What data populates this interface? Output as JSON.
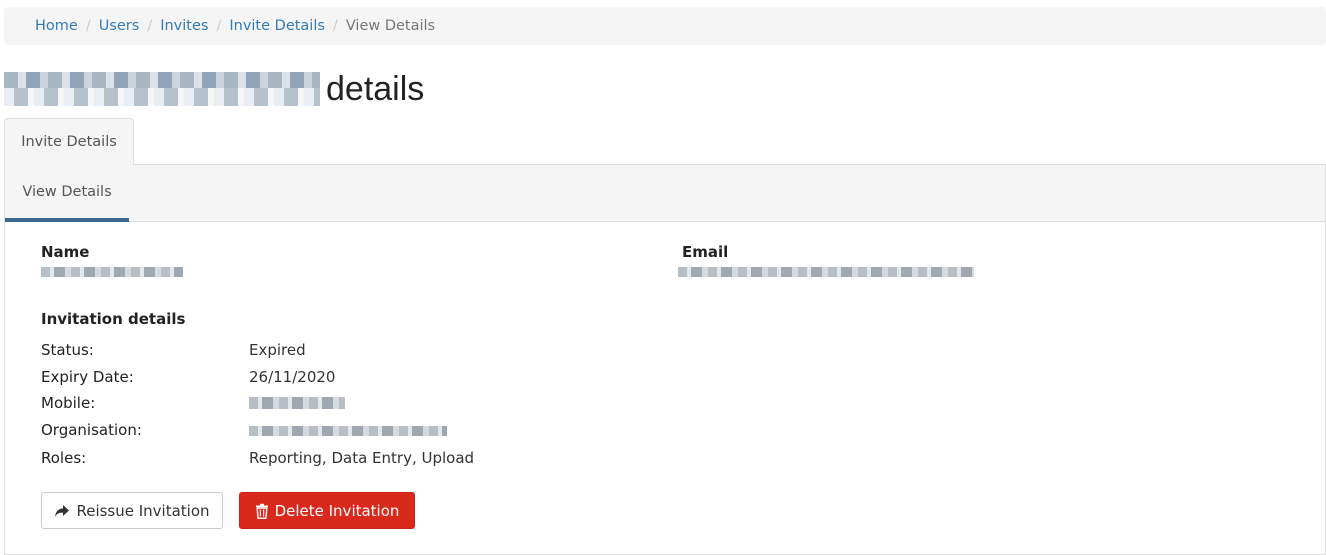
{
  "breadcrumb": {
    "items": [
      "Home",
      "Users",
      "Invites",
      "Invite Details",
      "View Details"
    ],
    "separator": "/"
  },
  "page": {
    "title_suffix": "details"
  },
  "tabs": {
    "outer": "Invite Details",
    "inner": "View Details"
  },
  "contact": {
    "name_label": "Name",
    "email_label": "Email"
  },
  "invitation": {
    "heading": "Invitation details",
    "status_label": "Status:",
    "status_value": "Expired",
    "expiry_label": "Expiry Date:",
    "expiry_value": "26/11/2020",
    "mobile_label": "Mobile:",
    "organisation_label": "Organisation:",
    "roles_label": "Roles:",
    "roles_value": "Reporting, Data Entry, Upload"
  },
  "actions": {
    "reissue_label": "Reissue Invitation",
    "delete_label": "Delete Invitation"
  },
  "colors": {
    "accent_tab": "#3d6a91",
    "danger": "#d9281c",
    "link": "#337ab7"
  }
}
